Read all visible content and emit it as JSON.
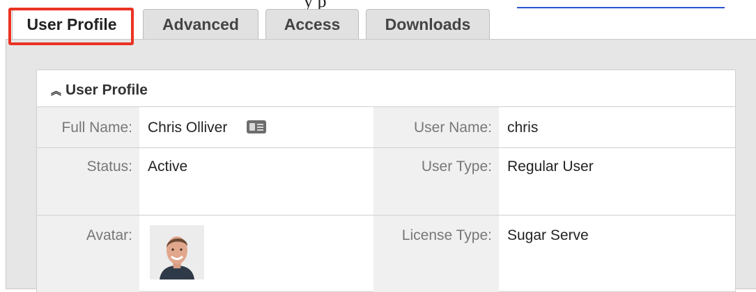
{
  "tabs": [
    {
      "label": "User Profile",
      "active": true
    },
    {
      "label": "Advanced",
      "active": false
    },
    {
      "label": "Access",
      "active": false
    },
    {
      "label": "Downloads",
      "active": false
    }
  ],
  "highlight_color": "#ea3323",
  "panel": {
    "title": "User Profile",
    "collapse_icon": "double-chevron-up-icon",
    "fields": {
      "full_name": {
        "label": "Full Name:",
        "value": "Chris Olliver"
      },
      "user_name": {
        "label": "User Name:",
        "value": "chris"
      },
      "status": {
        "label": "Status:",
        "value": "Active"
      },
      "user_type": {
        "label": "User Type:",
        "value": "Regular User"
      },
      "avatar": {
        "label": "Avatar:"
      },
      "license_type": {
        "label": "License Type:",
        "value": "Sugar Serve"
      }
    }
  },
  "icons": {
    "contact_card": "vcard-icon"
  }
}
